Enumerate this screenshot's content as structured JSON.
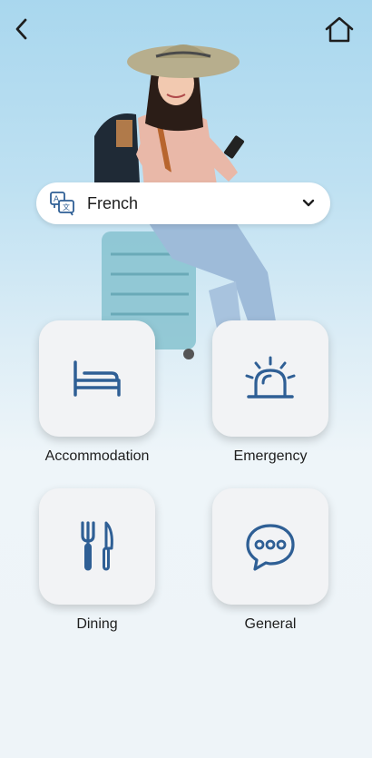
{
  "language_selector": {
    "value": "French"
  },
  "categories": [
    {
      "label": "Accommodation",
      "icon": "bed-icon"
    },
    {
      "label": "Emergency",
      "icon": "siren-icon"
    },
    {
      "label": "Dining",
      "icon": "fork-knife-icon"
    },
    {
      "label": "General",
      "icon": "chat-bubble-icon"
    }
  ],
  "colors": {
    "icon": "#2f5f95",
    "tile": "#f2f3f5"
  }
}
